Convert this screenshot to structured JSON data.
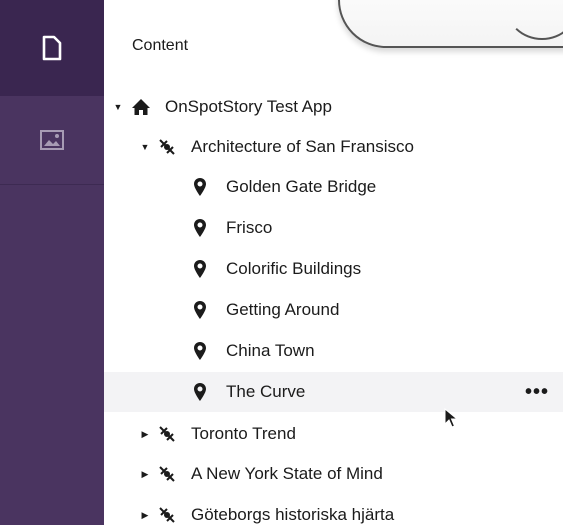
{
  "sidebar": {
    "items": [
      {
        "name": "content-section",
        "icon": "document-icon",
        "active": true
      },
      {
        "name": "media-section",
        "icon": "image-icon",
        "active": false
      }
    ]
  },
  "tree": {
    "header": "Content",
    "root": {
      "label": "OnSpotStory Test App",
      "icon": "home-icon",
      "expanded": true
    },
    "stories": [
      {
        "label": "Architecture of San Fransisco",
        "icon": "satellite-icon",
        "expanded": true
      },
      {
        "label": "Toronto Trend",
        "icon": "satellite-icon",
        "expanded": false
      },
      {
        "label": "A New York State of Mind",
        "icon": "satellite-icon",
        "expanded": false
      },
      {
        "label": "Göteborgs historiska hjärta",
        "icon": "satellite-icon",
        "expanded": false
      }
    ],
    "places": [
      {
        "label": "Golden Gate Bridge",
        "icon": "map-pin-icon"
      },
      {
        "label": "Frisco",
        "icon": "map-pin-icon"
      },
      {
        "label": "Colorific Buildings",
        "icon": "map-pin-icon"
      },
      {
        "label": "Getting Around",
        "icon": "map-pin-icon"
      },
      {
        "label": "China Town",
        "icon": "map-pin-icon"
      },
      {
        "label": "The Curve",
        "icon": "map-pin-icon",
        "selected": true
      }
    ],
    "more_actions": "•••"
  },
  "colors": {
    "rail": "#4a3460",
    "rail_active": "#3a2650",
    "selected_row": "#f3f3f5"
  }
}
